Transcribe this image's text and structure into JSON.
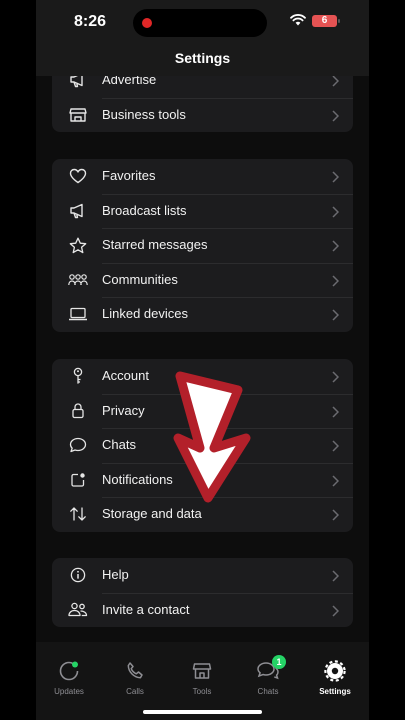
{
  "status_bar": {
    "time": "8:26",
    "battery": "6"
  },
  "header": {
    "title": "Settings"
  },
  "groups": {
    "business": [
      {
        "label": "Advertise",
        "icon": "megaphone-icon"
      },
      {
        "label": "Business tools",
        "icon": "storefront-icon"
      }
    ],
    "lists": [
      {
        "label": "Favorites",
        "icon": "heart-icon"
      },
      {
        "label": "Broadcast lists",
        "icon": "megaphone-icon"
      },
      {
        "label": "Starred messages",
        "icon": "star-icon"
      },
      {
        "label": "Communities",
        "icon": "communities-icon"
      },
      {
        "label": "Linked devices",
        "icon": "laptop-icon"
      }
    ],
    "settings": [
      {
        "label": "Account",
        "icon": "key-icon"
      },
      {
        "label": "Privacy",
        "icon": "lock-icon"
      },
      {
        "label": "Chats",
        "icon": "chat-bubble-icon"
      },
      {
        "label": "Notifications",
        "icon": "notification-icon"
      },
      {
        "label": "Storage and data",
        "icon": "arrows-updown-icon"
      }
    ],
    "help": [
      {
        "label": "Help",
        "icon": "info-icon"
      },
      {
        "label": "Invite a contact",
        "icon": "people-icon"
      }
    ]
  },
  "tabbar": {
    "tabs": [
      {
        "label": "Updates",
        "icon": "updates-icon"
      },
      {
        "label": "Calls",
        "icon": "phone-icon"
      },
      {
        "label": "Tools",
        "icon": "tools-icon"
      },
      {
        "label": "Chats",
        "icon": "chats-icon",
        "badge": "1"
      },
      {
        "label": "Settings",
        "icon": "settings-icon",
        "active": true
      }
    ]
  },
  "colors": {
    "accent_green": "#25d366",
    "annotation_red": "#b3202a",
    "recording_dot": "#e02727"
  }
}
